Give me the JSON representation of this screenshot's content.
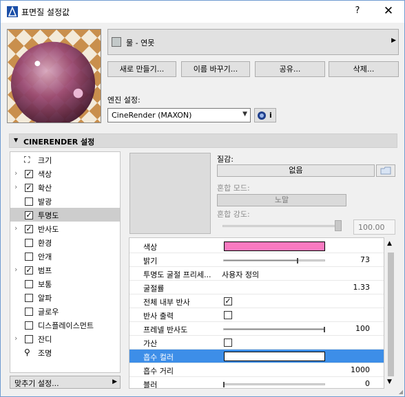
{
  "window": {
    "title": "표면질 설정값",
    "help": "?",
    "close": "✕"
  },
  "material": {
    "name": "물 - 연못",
    "swatch_color": "#c3c9c9"
  },
  "buttons": {
    "new": "새로 만들기...",
    "rename": "이름 바꾸기...",
    "share": "공유...",
    "delete": "삭제..."
  },
  "engine": {
    "label": "엔진 설정:",
    "value": "CineRender (MAXON)",
    "info": "i"
  },
  "section": {
    "title": "CINERENDER 설정"
  },
  "channels": [
    {
      "label": "크기",
      "expandable": false,
      "checkbox": "none"
    },
    {
      "label": "색상",
      "expandable": true,
      "checkbox": "checked"
    },
    {
      "label": "확산",
      "expandable": true,
      "checkbox": "checked"
    },
    {
      "label": "발광",
      "expandable": false,
      "checkbox": "unchecked"
    },
    {
      "label": "투명도",
      "expandable": false,
      "checkbox": "checked",
      "selected": true
    },
    {
      "label": "반사도",
      "expandable": true,
      "checkbox": "checked"
    },
    {
      "label": "환경",
      "expandable": false,
      "checkbox": "unchecked"
    },
    {
      "label": "안개",
      "expandable": false,
      "checkbox": "unchecked"
    },
    {
      "label": "범프",
      "expandable": true,
      "checkbox": "checked"
    },
    {
      "label": "보통",
      "expandable": false,
      "checkbox": "unchecked"
    },
    {
      "label": "알파",
      "expandable": false,
      "checkbox": "unchecked"
    },
    {
      "label": "글로우",
      "expandable": false,
      "checkbox": "unchecked"
    },
    {
      "label": "디스플레이스먼트",
      "expandable": false,
      "checkbox": "unchecked"
    },
    {
      "label": "잔디",
      "expandable": true,
      "checkbox": "unchecked"
    },
    {
      "label": "조명",
      "expandable": false,
      "checkbox": "none"
    }
  ],
  "fit_settings": {
    "label": "맞추기 설정..."
  },
  "texture": {
    "label": "질감:",
    "none_button": "없음",
    "blend_mode_label": "혼합 모드:",
    "blend_mode_value": "노말",
    "blend_strength_label": "혼합 강도:",
    "blend_strength_value": "100.00"
  },
  "properties": [
    {
      "name": "색상",
      "kind": "color",
      "color": "#f97ac0"
    },
    {
      "name": "밝기",
      "kind": "slider",
      "value": "73",
      "fraction": 0.73
    },
    {
      "name": "투명도 굴절 프리세...",
      "kind": "text",
      "value": "사용자 정의"
    },
    {
      "name": "굴절률",
      "kind": "number",
      "value": "1.33"
    },
    {
      "name": "전체 내부 반사",
      "kind": "check",
      "checked": true
    },
    {
      "name": "반사 출력",
      "kind": "check",
      "checked": false
    },
    {
      "name": "프레넬 반사도",
      "kind": "slider",
      "value": "100",
      "fraction": 1.0
    },
    {
      "name": "가산",
      "kind": "check",
      "checked": false
    },
    {
      "name": "흡수 컬러",
      "kind": "color",
      "color": "#ffffff",
      "selected": true
    },
    {
      "name": "흡수 거리",
      "kind": "number",
      "value": "1000"
    },
    {
      "name": "블러",
      "kind": "slider",
      "value": "0",
      "fraction": 0.0
    }
  ],
  "colors": {
    "selection_blue": "#3d8ee8",
    "pink": "#f97ac0"
  }
}
